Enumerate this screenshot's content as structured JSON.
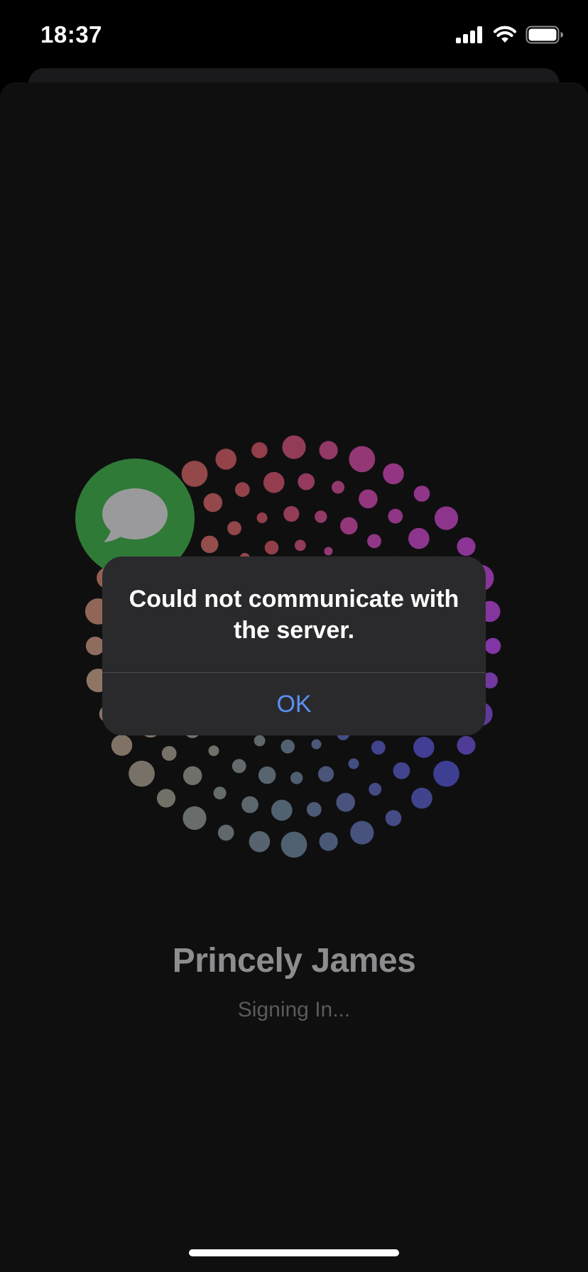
{
  "status_bar": {
    "time": "18:37",
    "icons": [
      "cellular-signal-icon",
      "wifi-icon",
      "battery-icon"
    ]
  },
  "account": {
    "name": "Princely James",
    "status": "Signing In..."
  },
  "app_icon": "messages-icon",
  "alert": {
    "message": "Could not communicate with the server.",
    "ok_label": "OK",
    "ok_color": "#5a90f2"
  },
  "colors": {
    "background": "#0f0f10",
    "alert_background": "#2a2a2d",
    "messages_green": "#2f7a37"
  }
}
